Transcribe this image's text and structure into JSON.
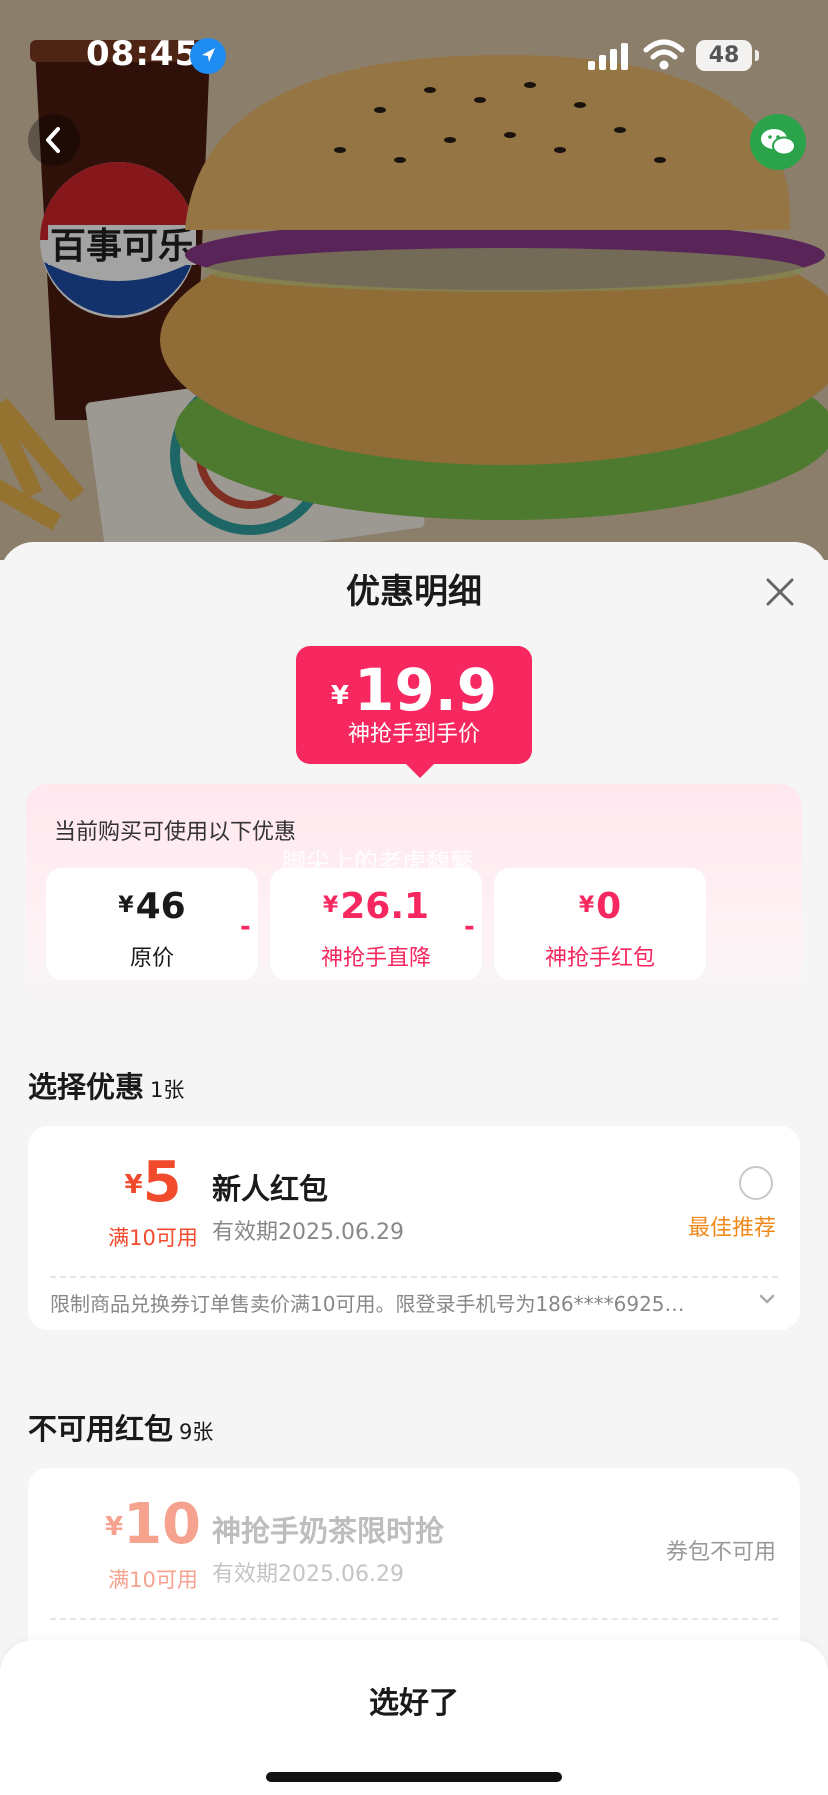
{
  "status_bar": {
    "time": "08:45",
    "battery": "48",
    "icons": [
      "location-arrow-icon",
      "signal-icon",
      "wifi-icon",
      "battery-icon"
    ]
  },
  "hero": {
    "logo_text": "百事可乐",
    "icons": [
      "back-chevron-icon",
      "wechat-icon"
    ]
  },
  "sheet": {
    "title": "优惠明细",
    "close_icon": "close-icon",
    "final_price": {
      "currency": "¥",
      "amount": "19.9",
      "label": "神抢手到手价"
    },
    "discount_panel": {
      "title": "当前购买可使用以下优惠",
      "watermark": "脚尖上的老虎馥蘩",
      "operator": "-",
      "items": [
        {
          "currency": "¥",
          "amount": "46",
          "label": "原价"
        },
        {
          "currency": "¥",
          "amount": "26.1",
          "label": "神抢手直降"
        },
        {
          "currency": "¥",
          "amount": "0",
          "label": "神抢手红包"
        }
      ]
    },
    "select_section": {
      "title": "选择优惠",
      "count": "1张",
      "coupons": [
        {
          "currency": "¥",
          "amount": "5",
          "condition": "满10可用",
          "name": "新人红包",
          "expiry": "有效期2025.06.29",
          "tag": "最佳推荐",
          "selected": false,
          "description": "限制商品兑换券订单售卖价满10可用。限登录手机号为186****6925…"
        }
      ]
    },
    "unavailable_section": {
      "title": "不可用红包",
      "count": "9张",
      "coupons": [
        {
          "currency": "¥",
          "amount": "10",
          "condition": "满10可用",
          "name": "神抢手奶茶限时抢",
          "expiry": "有效期2025.06.29",
          "status": "券包不可用"
        }
      ]
    }
  },
  "footer": {
    "confirm_label": "选好了"
  },
  "colors": {
    "brand_pink": "#f7275f",
    "coupon_red": "#f24a2c",
    "recommend_orange": "#f08a1c",
    "disabled_red": "#f5a28f"
  }
}
